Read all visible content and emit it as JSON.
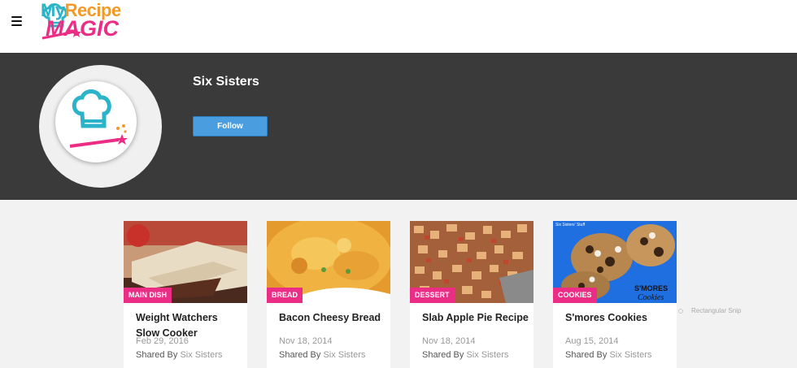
{
  "header": {
    "logo_line1_a": "My",
    "logo_line1_b": "Recipe",
    "logo_line2": "MAGIC"
  },
  "profile": {
    "name": "Six Sisters",
    "follow_label": "Follow"
  },
  "cards": [
    {
      "tag": "MAIN DISH",
      "title": "Weight Watchers Slow Cooker",
      "date": "Feb 29, 2016",
      "shared_by_label": "Shared By",
      "author": "Six Sisters"
    },
    {
      "tag": "BREAD",
      "title": "Bacon Cheesy Bread",
      "date": "Nov 18, 2014",
      "shared_by_label": "Shared By",
      "author": "Six Sisters"
    },
    {
      "tag": "DESSERT",
      "title": "Slab Apple Pie Recipe",
      "date": "Nov 18, 2014",
      "shared_by_label": "Shared By",
      "author": "Six Sisters"
    },
    {
      "tag": "COOKIES",
      "title": "S'mores Cookies",
      "date": "Aug 15, 2014",
      "shared_by_label": "Shared By",
      "author": "Six Sisters"
    }
  ],
  "cookie_image": {
    "watermark": "Six Sisters' Stuff",
    "caption_line1": "S'MORES",
    "caption_line2": "Cookies"
  },
  "overlay": {
    "snip_label": "Rectangular Snip"
  },
  "colors": {
    "accent_pink": "#ec2d86",
    "follow_blue": "#4a9ee0",
    "banner_dark": "#3a3a3a"
  }
}
